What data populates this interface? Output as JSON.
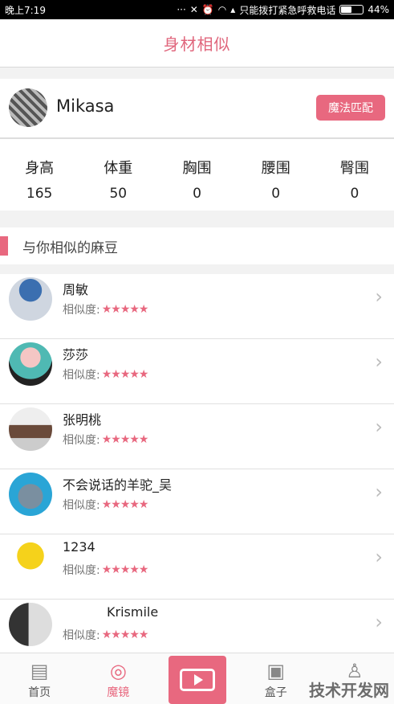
{
  "status_bar": {
    "time": "晚上7:19",
    "carrier_text": "只能拨打紧急呼救电话",
    "battery": "44%",
    "battery_level": 0.44
  },
  "header": {
    "title": "身材相似"
  },
  "profile": {
    "name": "Mikasa",
    "match_button": "魔法匹配"
  },
  "measurements": [
    {
      "label": "身高",
      "value": "165"
    },
    {
      "label": "体重",
      "value": "50"
    },
    {
      "label": "胸围",
      "value": "0"
    },
    {
      "label": "腰围",
      "value": "0"
    },
    {
      "label": "臀围",
      "value": "0"
    }
  ],
  "section": {
    "title": "与你相似的麻豆"
  },
  "similarity_label": "相似度:",
  "stars": "★★★★★",
  "people": [
    {
      "name": "周敏",
      "rating": 5
    },
    {
      "name": "莎莎",
      "rating": 5
    },
    {
      "name": "张明桃",
      "rating": 5
    },
    {
      "name": "不会说话的羊驼_吴",
      "rating": 5
    },
    {
      "name": "1234",
      "rating": 5
    },
    {
      "name": "Krismile",
      "rating": 5
    }
  ],
  "tabs": [
    {
      "label": "首页",
      "icon": "home-icon",
      "active": false
    },
    {
      "label": "魔镜",
      "icon": "mirror-icon",
      "active": true
    },
    {
      "label": "",
      "icon": "video-camera-icon",
      "active": false
    },
    {
      "label": "盒子",
      "icon": "gift-box-icon",
      "active": false
    },
    {
      "label": "",
      "icon": "person-icon",
      "active": false
    }
  ],
  "watermark": "技术开发网",
  "colors": {
    "accent": "#e8687f",
    "title": "#e0667c"
  }
}
